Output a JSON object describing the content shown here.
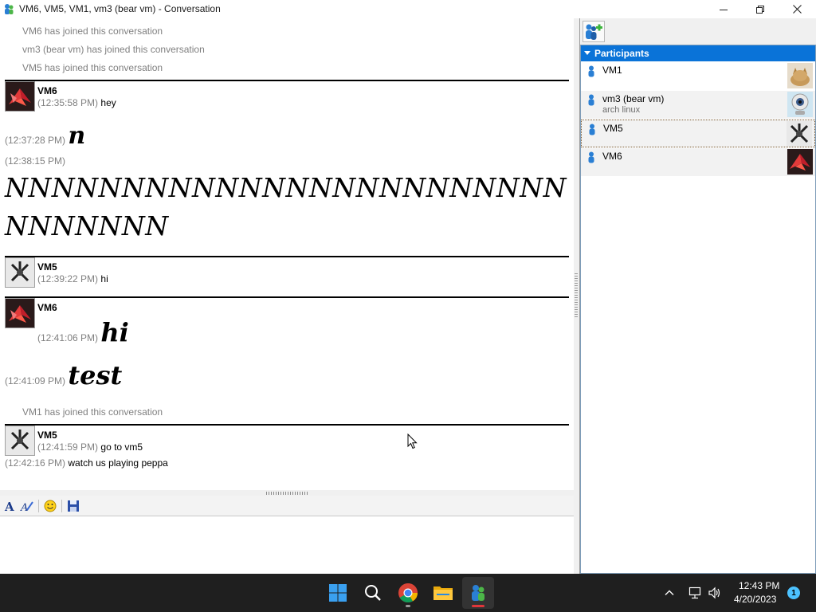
{
  "window": {
    "title": "VM6, VM5, VM1, vm3 (bear vm) - Conversation"
  },
  "conversation": {
    "system_messages": [
      "VM6 has joined this conversation",
      "vm3 (bear vm) has joined this conversation",
      "VM5 has joined this conversation",
      "VM1 has joined this conversation"
    ],
    "blocks": [
      {
        "sender": "VM6",
        "messages": [
          {
            "time": "(12:35:58 PM)",
            "text": "hey"
          },
          {
            "time": "(12:37:28 PM)",
            "text": "n"
          },
          {
            "time": "(12:38:15 PM)",
            "text": "NNNNNNNNNNNNNNNNNNNNNNNNNNNNNNN"
          }
        ]
      },
      {
        "sender": "VM5",
        "messages": [
          {
            "time": "(12:39:22 PM)",
            "text": "hi"
          }
        ]
      },
      {
        "sender": "VM6",
        "messages": [
          {
            "time": "(12:41:06 PM)",
            "text": "hi"
          },
          {
            "time": "(12:41:09 PM)",
            "text": "test"
          }
        ]
      },
      {
        "sender": "VM5",
        "messages": [
          {
            "time": "(12:41:59 PM)",
            "text": "go to vm5"
          },
          {
            "time": "(12:42:16 PM)",
            "text": "watch us playing peppa"
          }
        ]
      }
    ]
  },
  "toolbar": {
    "icons": [
      "font-icon",
      "font-color-icon",
      "emoticon-icon",
      "save-icon"
    ]
  },
  "participants": {
    "header": "Participants",
    "list": [
      {
        "name": "VM1",
        "status": "",
        "avatar": "cat-avatar"
      },
      {
        "name": "vm3 (bear vm)",
        "status": "arch linux",
        "avatar": "webcam-avatar"
      },
      {
        "name": "VM5",
        "status": "",
        "avatar": "soccer-avatar"
      },
      {
        "name": "VM6",
        "status": "",
        "avatar": "crane-avatar"
      }
    ]
  },
  "taskbar": {
    "apps": [
      "start-icon",
      "search-icon",
      "chrome-icon",
      "file-explorer-icon",
      "messenger-icon"
    ],
    "time": "12:43 PM",
    "date": "4/20/2023",
    "notification_count": "1"
  },
  "colors": {
    "accent": "#0a73d8",
    "timestamp": "#808080"
  }
}
